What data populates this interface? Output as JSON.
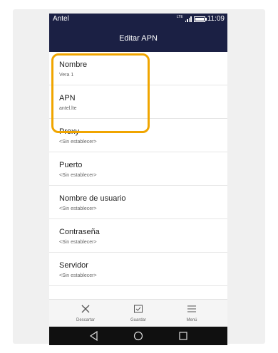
{
  "status": {
    "carrier": "Antel",
    "network": "LTE",
    "time": "11:09"
  },
  "appbar": {
    "title": "Editar APN"
  },
  "settings": [
    {
      "title": "Nombre",
      "value": "Vera 1"
    },
    {
      "title": "APN",
      "value": "antel.lte"
    },
    {
      "title": "Proxy",
      "value": "<Sin establecer>"
    },
    {
      "title": "Puerto",
      "value": "<Sin establecer>"
    },
    {
      "title": "Nombre de usuario",
      "value": "<Sin establecer>"
    },
    {
      "title": "Contraseña",
      "value": "<Sin establecer>"
    },
    {
      "title": "Servidor",
      "value": "<Sin establecer>"
    }
  ],
  "bottom_actions": [
    {
      "label": "Descartar",
      "icon": "close-icon"
    },
    {
      "label": "Guardar",
      "icon": "save-check-icon"
    },
    {
      "label": "Menú",
      "icon": "menu-icon"
    }
  ],
  "nav": [
    "back-icon",
    "home-icon",
    "recents-icon"
  ],
  "colors": {
    "appbar": "#1b2044",
    "highlight": "#f0a500",
    "navbar": "#101010"
  }
}
